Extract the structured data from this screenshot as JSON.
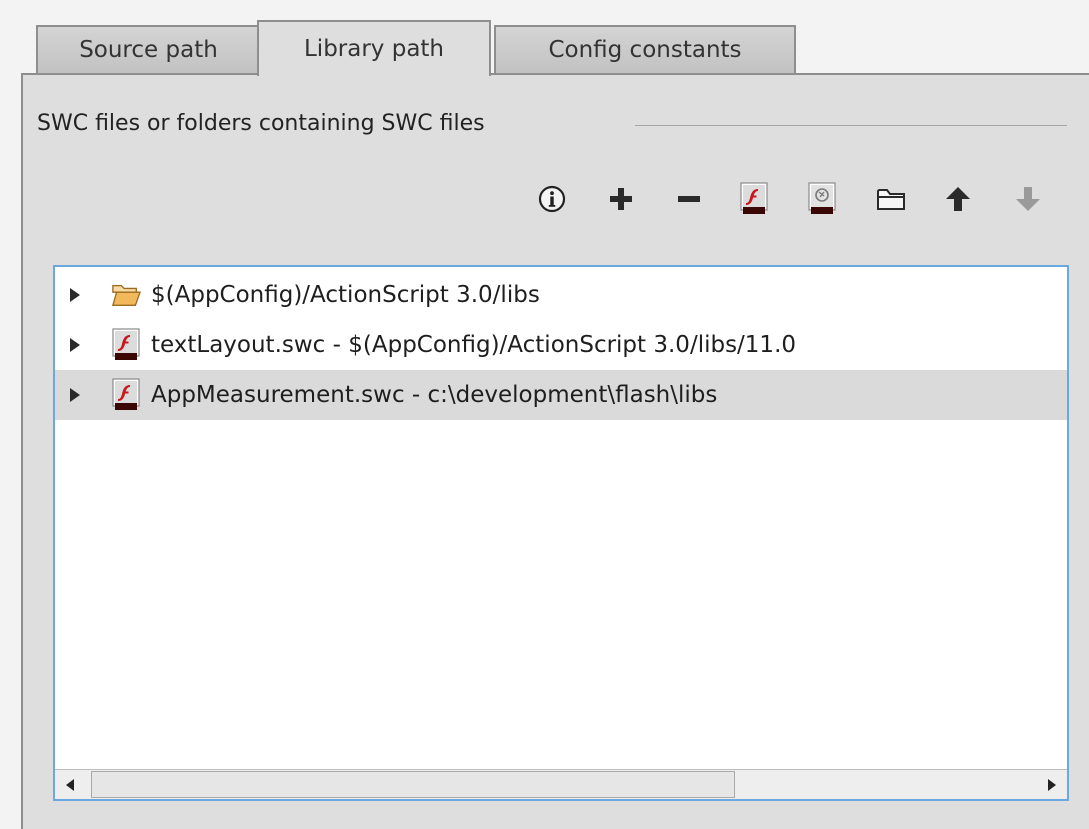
{
  "tabs": [
    {
      "label": "Source path",
      "active": false
    },
    {
      "label": "Library path",
      "active": true
    },
    {
      "label": "Config constants",
      "active": false
    }
  ],
  "section": {
    "title": "SWC files or folders containing SWC files"
  },
  "toolbar": {
    "buttons": [
      {
        "icon": "info-icon"
      },
      {
        "icon": "add-icon"
      },
      {
        "icon": "remove-icon"
      },
      {
        "icon": "add-swc-icon"
      },
      {
        "icon": "add-ane-icon"
      },
      {
        "icon": "folder-icon"
      },
      {
        "icon": "move-up-icon"
      },
      {
        "icon": "move-down-icon",
        "disabled": true
      }
    ]
  },
  "library_items": [
    {
      "icon": "open-folder-icon",
      "label": "$(AppConfig)/ActionScript 3.0/libs"
    },
    {
      "icon": "swc-file-icon",
      "label": "textLayout.swc - $(AppConfig)/ActionScript 3.0/libs/11.0"
    },
    {
      "icon": "swc-file-icon",
      "label": "AppMeasurement.swc - c:\\development\\flash\\libs",
      "selected": true
    }
  ],
  "colors": {
    "panel_bg": "#dedede",
    "list_border": "#6aa8e0",
    "selected_row": "#dadada",
    "flash_red": "#c8181e",
    "folder": "#f2b95c"
  }
}
